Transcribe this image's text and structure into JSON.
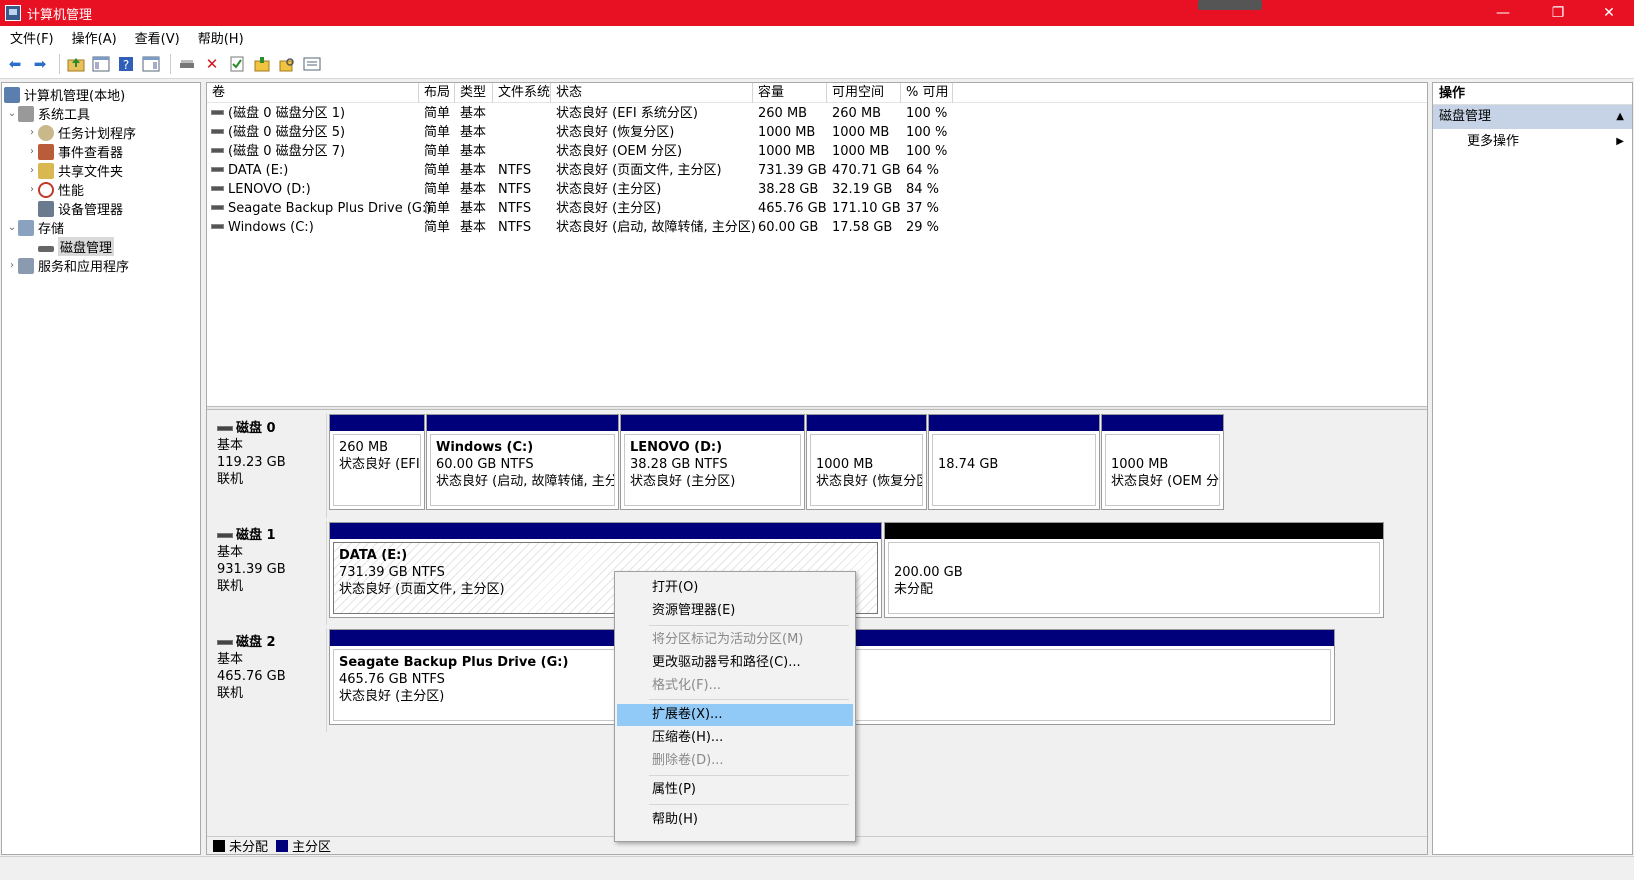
{
  "window": {
    "title": "计算机管理",
    "minimize": "—",
    "restore": "❐",
    "close": "✕"
  },
  "menu": [
    "文件(F)",
    "操作(A)",
    "查看(V)",
    "帮助(H)"
  ],
  "tree": {
    "root": "计算机管理(本地)",
    "system_tools": "系统工具",
    "task_scheduler": "任务计划程序",
    "event_viewer": "事件查看器",
    "shared_folders": "共享文件夹",
    "performance": "性能",
    "device_manager": "设备管理器",
    "storage": "存储",
    "disk_management": "磁盘管理",
    "services_apps": "服务和应用程序"
  },
  "list": {
    "headers": [
      "卷",
      "布局",
      "类型",
      "文件系统",
      "状态",
      "容量",
      "可用空间",
      "% 可用"
    ],
    "rows": [
      [
        "(磁盘 0 磁盘分区 1)",
        "简单",
        "基本",
        "",
        "状态良好 (EFI 系统分区)",
        "260 MB",
        "260 MB",
        "100 %"
      ],
      [
        "(磁盘 0 磁盘分区 5)",
        "简单",
        "基本",
        "",
        "状态良好 (恢复分区)",
        "1000 MB",
        "1000 MB",
        "100 %"
      ],
      [
        "(磁盘 0 磁盘分区 7)",
        "简单",
        "基本",
        "",
        "状态良好 (OEM 分区)",
        "1000 MB",
        "1000 MB",
        "100 %"
      ],
      [
        "DATA (E:)",
        "简单",
        "基本",
        "NTFS",
        "状态良好 (页面文件, 主分区)",
        "731.39 GB",
        "470.71 GB",
        "64 %"
      ],
      [
        "LENOVO (D:)",
        "简单",
        "基本",
        "NTFS",
        "状态良好 (主分区)",
        "38.28 GB",
        "32.19 GB",
        "84 %"
      ],
      [
        "Seagate Backup Plus Drive (G:)",
        "简单",
        "基本",
        "NTFS",
        "状态良好 (主分区)",
        "465.76 GB",
        "171.10 GB",
        "37 %"
      ],
      [
        "Windows (C:)",
        "简单",
        "基本",
        "NTFS",
        "状态良好 (启动, 故障转储, 主分区)",
        "60.00 GB",
        "17.58 GB",
        "29 %"
      ]
    ]
  },
  "disks": {
    "d0": {
      "name": "磁盘 0",
      "type": "基本",
      "size": "119.23 GB",
      "status": "联机",
      "p1": {
        "l1": "260 MB",
        "l2": "状态良好 (EFI 系"
      },
      "p2": {
        "title": "Windows  (C:)",
        "l1": "60.00 GB NTFS",
        "l2": "状态良好 (启动, 故障转储, 主分区"
      },
      "p3": {
        "title": "LENOVO  (D:)",
        "l1": "38.28 GB NTFS",
        "l2": "状态良好 (主分区)"
      },
      "p4": {
        "l1": "1000 MB",
        "l2": "状态良好 (恢复分区"
      },
      "p5": {
        "l1": "18.74 GB"
      },
      "p6": {
        "l1": "1000 MB",
        "l2": "状态良好 (OEM 分区"
      }
    },
    "d1": {
      "name": "磁盘 1",
      "type": "基本",
      "size": "931.39 GB",
      "status": "联机",
      "p1": {
        "title": "DATA  (E:)",
        "l1": "731.39 GB NTFS",
        "l2": "状态良好 (页面文件, 主分区)"
      },
      "p2": {
        "l1": "200.00 GB",
        "l2": "未分配"
      }
    },
    "d2": {
      "name": "磁盘 2",
      "type": "基本",
      "size": "465.76 GB",
      "status": "联机",
      "p1": {
        "title": "Seagate Backup Plus Drive  (G:)",
        "l1": "465.76 GB NTFS",
        "l2": "状态良好 (主分区)"
      }
    }
  },
  "legend": {
    "unallocated": "未分配",
    "primary": "主分区"
  },
  "actions": {
    "title": "操作",
    "section": "磁盘管理",
    "more": "更多操作"
  },
  "context_menu": {
    "open": "打开(O)",
    "explore": "资源管理器(E)",
    "mark_active": "将分区标记为活动分区(M)",
    "change_letter": "更改驱动器号和路径(C)...",
    "format": "格式化(F)...",
    "extend": "扩展卷(X)...",
    "shrink": "压缩卷(H)...",
    "delete": "删除卷(D)...",
    "properties": "属性(P)",
    "help": "帮助(H)"
  },
  "colors": {
    "titlebar": "#e81123",
    "primary_bar": "#00007b",
    "unallocated_bar": "#000000",
    "highlight": "#91c9f7"
  }
}
